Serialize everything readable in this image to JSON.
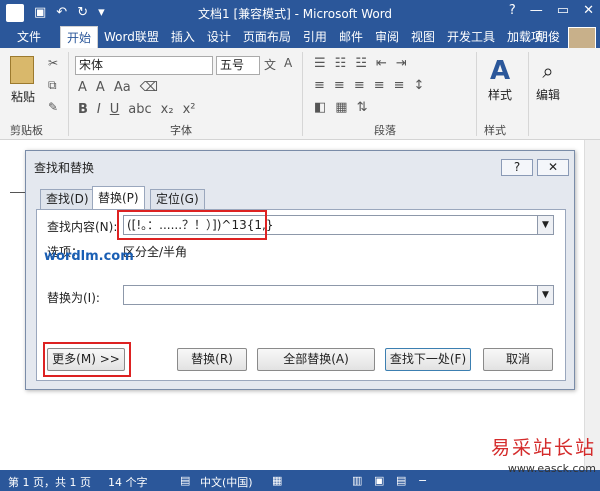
{
  "titlebar": {
    "title": "文档1 [兼容模式] - Microsoft Word",
    "help": "?",
    "minimize": "—",
    "restore": "▭",
    "close": "✕"
  },
  "tabs": {
    "file": "文件",
    "items": [
      "开始",
      "Word联盟",
      "插入",
      "设计",
      "页面布局",
      "引用",
      "邮件",
      "审阅",
      "视图",
      "开发工具",
      "加载项"
    ],
    "user": "胡俊"
  },
  "ribbon": {
    "paste": "粘贴",
    "clipboard_group": "剪贴板",
    "font_name": "宋体",
    "font_size": "五号",
    "font_group": "字体",
    "paragraph_group": "段落",
    "styles": "样式",
    "styles_group": "样式",
    "edit": "编辑"
  },
  "dialog": {
    "title": "查找和替换",
    "help_btn": "?",
    "close_btn": "✕",
    "tabs": [
      "查找(D)",
      "替换(P)",
      "定位(G)"
    ],
    "find_label": "查找内容(N):",
    "find_value": "([!。：......？！）])^13{1,}",
    "options_label": "选项：",
    "options_value": "区分全/半角",
    "replace_label": "替换为(I):",
    "replace_value": "",
    "more_btn": "更多(M) >>",
    "replace_btn": "替换(R)",
    "replace_all_btn": "全部替换(A)",
    "find_next_btn": "查找下一处(F)",
    "cancel_btn": "取消"
  },
  "watermark": "wordlm.com",
  "statusbar": {
    "page": "第 1 页，共 1 页",
    "words": "14 个字",
    "lang": "中文(中国)"
  },
  "brand": {
    "name": "易采站长站",
    "url": "www.easck.com"
  }
}
